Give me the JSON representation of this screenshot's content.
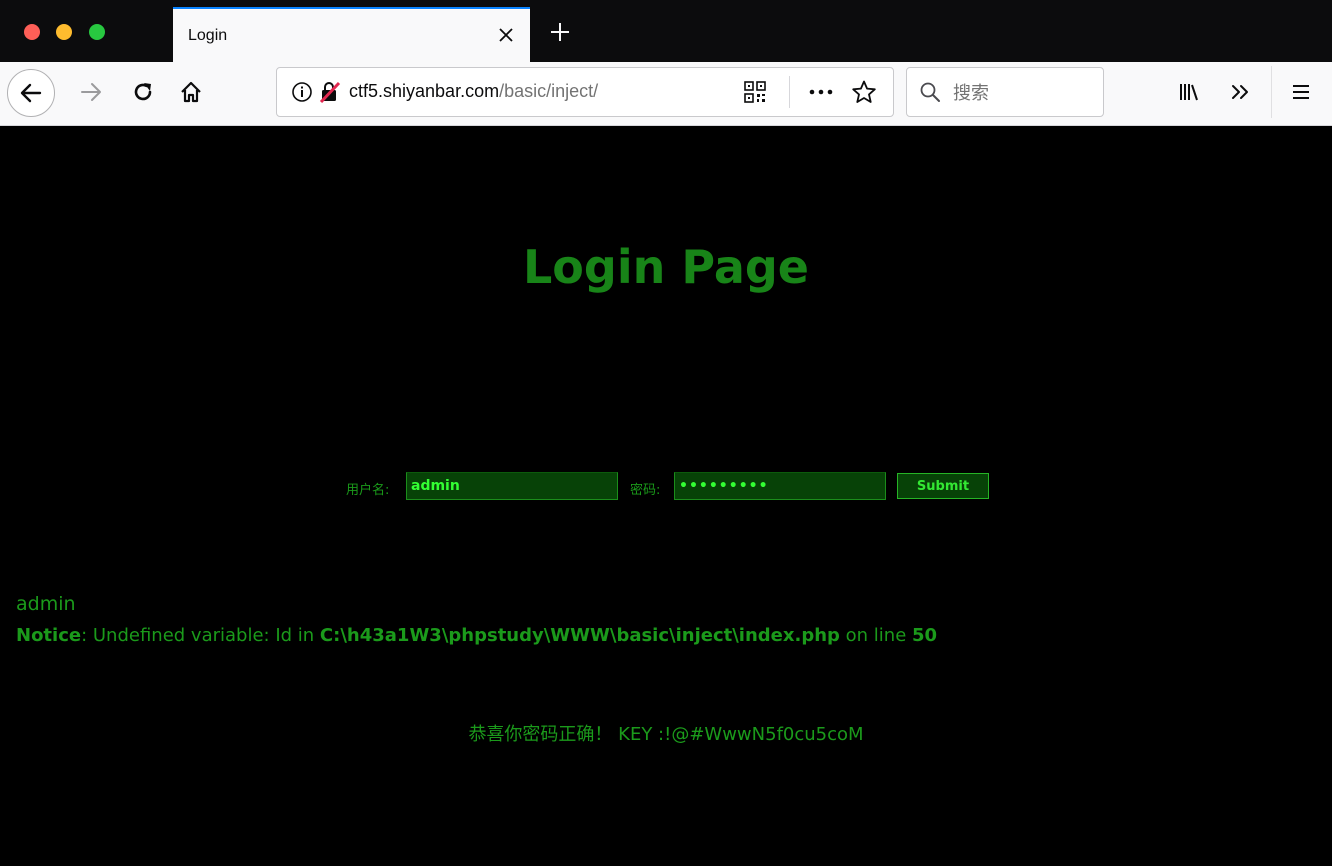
{
  "browser": {
    "tab_title": "Login",
    "url_host": "ctf5.shiyanbar.com",
    "url_path": "/basic/inject/",
    "search_placeholder": "搜索",
    "icons": {
      "close": "close-icon",
      "new_tab": "plus-icon",
      "back": "back-arrow-icon",
      "forward": "forward-arrow-icon",
      "reload": "reload-icon",
      "home": "home-icon",
      "info": "info-icon",
      "insecure": "insecure-lock-icon",
      "qr": "qr-code-icon",
      "more": "more-icon",
      "bookmark": "star-icon",
      "search": "search-icon",
      "library": "library-icon",
      "overflow": "overflow-chevrons-icon",
      "menu": "hamburger-menu-icon"
    },
    "colors": {
      "tab_accent": "#0a84ff",
      "chrome_dark": "#0c0c0d",
      "toolbar_bg": "#f9f9fa"
    }
  },
  "page": {
    "title": "Login Page",
    "form": {
      "username_label": "用户名:",
      "username_value": "admin",
      "password_label": "密码:",
      "password_value": "•••••••••",
      "submit_label": "Submit"
    },
    "echo_username": "admin",
    "notice": {
      "label": "Notice",
      "text_1": ": Undefined variable: Id in ",
      "path": "C:\\h43a1W3\\phpstudy\\WWW\\basic\\inject\\index.php",
      "text_2": " on line ",
      "line": "50"
    },
    "result_message": "恭喜你密码正确！ KEY :!@#WwwN5f0cu5coM",
    "colors": {
      "background": "#000000",
      "text_green": "#1b9a1b",
      "title_green": "#188418",
      "field_bg": "#074207",
      "field_text": "#33ff33"
    }
  }
}
